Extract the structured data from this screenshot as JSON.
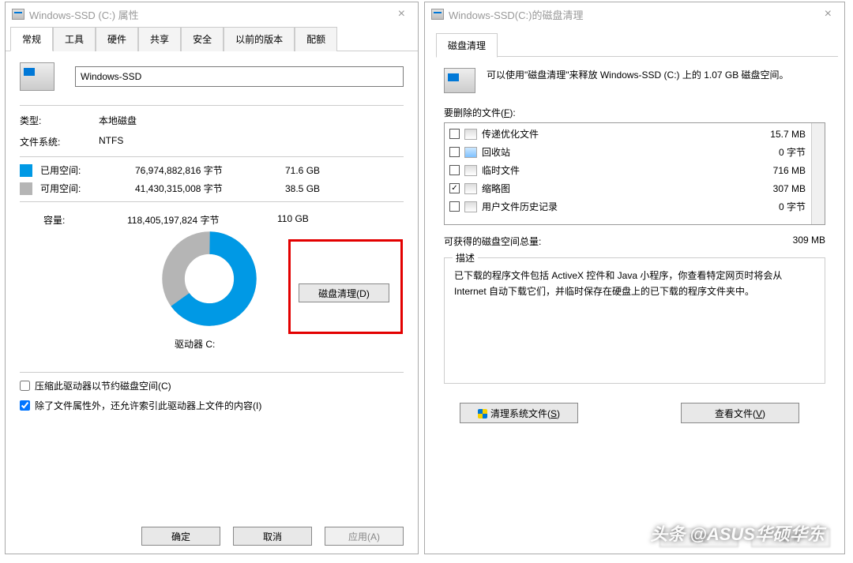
{
  "left": {
    "title": "Windows-SSD (C:) 属性",
    "tabs": [
      "常规",
      "工具",
      "硬件",
      "共享",
      "安全",
      "以前的版本",
      "配额"
    ],
    "drive_name": "Windows-SSD",
    "type_label": "类型:",
    "type_value": "本地磁盘",
    "fs_label": "文件系统:",
    "fs_value": "NTFS",
    "used_label": "已用空间:",
    "used_bytes": "76,974,882,816 字节",
    "used_gb": "71.6 GB",
    "free_label": "可用空间:",
    "free_bytes": "41,430,315,008 字节",
    "free_gb": "38.5 GB",
    "cap_label": "容量:",
    "cap_bytes": "118,405,197,824 字节",
    "cap_gb": "110 GB",
    "drive_letter_cap": "驱动器 C:",
    "cleanup_btn": "磁盘清理(D)",
    "compress_chk": "压缩此驱动器以节约磁盘空间(C)",
    "index_chk": "除了文件属性外，还允许索引此驱动器上文件的内容(I)",
    "ok": "确定",
    "cancel": "取消",
    "apply": "应用(A)"
  },
  "right": {
    "title": "Windows-SSD(C:)的磁盘清理",
    "tab": "磁盘清理",
    "desc": "可以使用\"磁盘清理\"来释放 Windows-SSD (C:) 上的 1.07 GB 磁盘空间。",
    "files_label_a": "要删除的文件(",
    "files_label_u": "F",
    "files_label_b": "):",
    "files": [
      {
        "name": "传递优化文件",
        "size": "15.7 MB",
        "checked": false
      },
      {
        "name": "回收站",
        "size": "0 字节",
        "checked": false,
        "icon": "recycle"
      },
      {
        "name": "临时文件",
        "size": "716 MB",
        "checked": false
      },
      {
        "name": "缩略图",
        "size": "307 MB",
        "checked": true
      },
      {
        "name": "用户文件历史记录",
        "size": "0 字节",
        "checked": false
      }
    ],
    "total_label": "可获得的磁盘空间总量:",
    "total_value": "309 MB",
    "group_title": "描述",
    "group_text": "已下载的程序文件包括 ActiveX 控件和 Java 小程序，你查看特定网页时将会从 Internet 自动下载它们，并临时保存在硬盘上的已下载的程序文件夹中。",
    "clean_sys_a": "清理系统文件(",
    "clean_sys_u": "S",
    "clean_sys_b": ")",
    "view_files_a": "查看文件(",
    "view_files_u": "V",
    "view_files_b": ")",
    "ok": "确定",
    "cancel": "取消"
  },
  "watermark": "头条 @ASUS华硕华东",
  "chart_data": {
    "type": "pie",
    "title": "驱动器 C:",
    "series": [
      {
        "name": "已用空间",
        "value": 71.6,
        "color": "#0099e5"
      },
      {
        "name": "可用空间",
        "value": 38.5,
        "color": "#b5b5b5"
      }
    ],
    "unit": "GB"
  }
}
